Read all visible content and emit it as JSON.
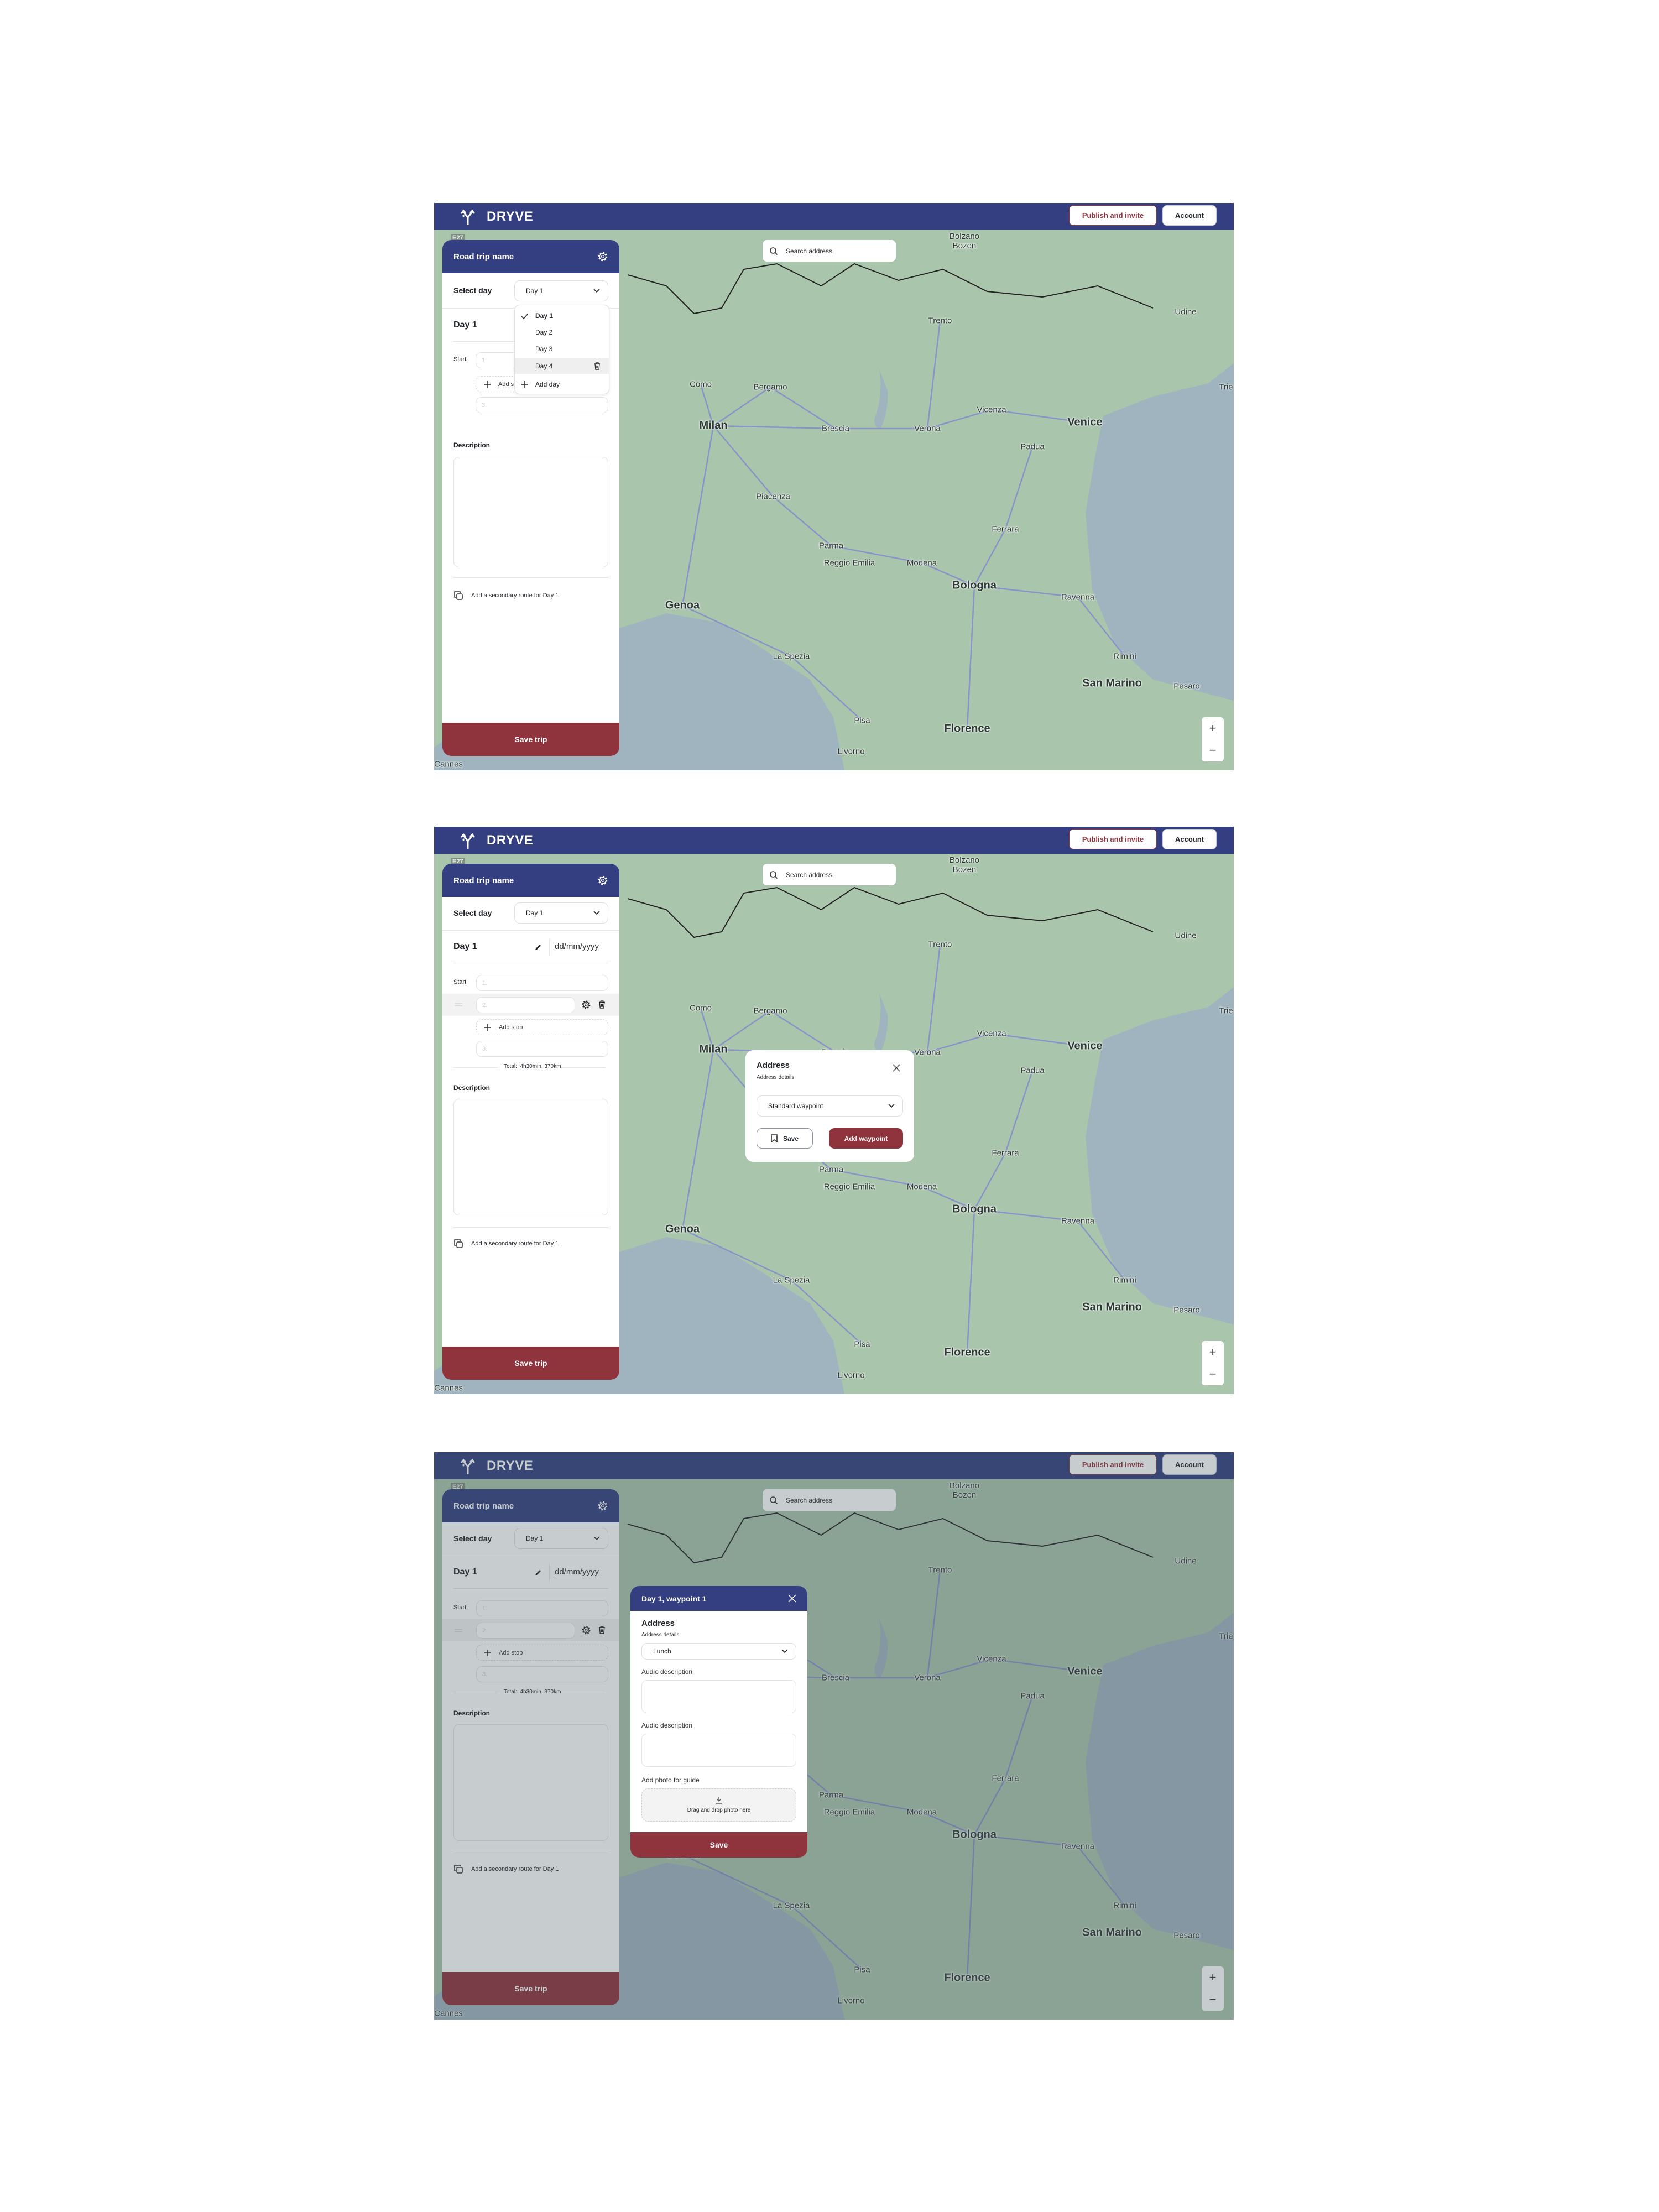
{
  "app": {
    "brand": "DRYVE",
    "publish_label": "Publish and invite",
    "account_label": "Account"
  },
  "search": {
    "placeholder": "Search address"
  },
  "map": {
    "labels": [
      "Bolzano\nBozen",
      "Trento",
      "Udine",
      "Trie",
      "Bergamo",
      "Como",
      "Milan",
      "Brescia",
      "Verona",
      "Vicenza",
      "Venice",
      "Padua",
      "Piacenza",
      "Ferrara",
      "Parma",
      "Reggio Emilia",
      "Modena",
      "Bologna",
      "Genoa",
      "Ravenna",
      "La Spezia",
      "Rimini",
      "San Marino",
      "Pesaro",
      "Pisa",
      "Florence",
      "Livorno",
      "Cannes"
    ],
    "road_shields": [
      "E27"
    ],
    "zoom_in": "+",
    "zoom_out": "−"
  },
  "sidebar": {
    "trip_name": "Road trip name",
    "select_day_label": "Select day",
    "selected_day": "Day 1",
    "day_title": "Day 1",
    "date_placeholder": "dd/mm/yyyy",
    "start_label": "Start",
    "stops": [
      "1.",
      "2.",
      "3."
    ],
    "add_stop": "Add stop",
    "add_stop_partial": "Add s",
    "total_label": "Total:",
    "total_value": "4h30min, 370km",
    "description_label": "Description",
    "secondary_route": "Add a secondary route for Day 1",
    "save_trip": "Save trip"
  },
  "day_menu": {
    "items": [
      "Day 1",
      "Day 2",
      "Day 3",
      "Day 4"
    ],
    "selected": "Day 1",
    "hovered": "Day 4",
    "add_day": "Add day"
  },
  "address_popup": {
    "title": "Address",
    "subtitle": "Address details",
    "waypoint_type": "Standard waypoint",
    "save_label": "Save",
    "add_label": "Add waypoint"
  },
  "waypoint_panel": {
    "title": "Day 1, waypoint 1",
    "address_title": "Address",
    "address_details": "Address details",
    "type_value": "Lunch",
    "audio_label_1": "Audio description",
    "audio_label_2": "Audio description",
    "photo_label": "Add photo for guide",
    "drop_text": "Drag and drop photo here",
    "save_label": "Save"
  },
  "colors": {
    "navy": "#333f80",
    "accent_red": "#8f333d",
    "map_land": "#a9c5ac",
    "map_water": "#9fb4bf"
  }
}
